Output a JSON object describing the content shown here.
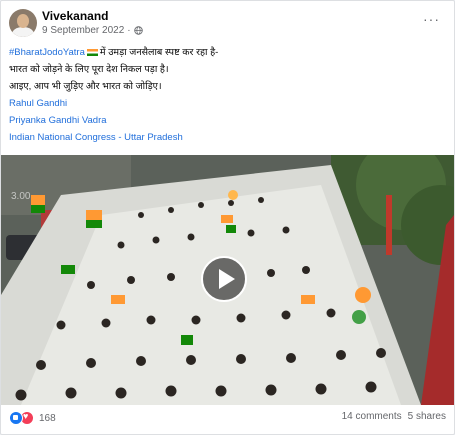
{
  "post": {
    "author": "Vivekanand",
    "date": "9 September 2022",
    "separator": "·",
    "more": "···",
    "hashtag": "#BharatJodoYatra",
    "line1_rest": "में उमड़ा जनसैलाब स्पष्ट कर रहा है-",
    "line2": "भारत को जोड़ने के लिए पूरा देश निकल पड़ा है।",
    "line3": "आइए, आप भी जुड़िए और भारत को जोड़िए।",
    "tags": [
      "Rahul Gandhi",
      "Priyanka Gandhi Vadra",
      "Indian National Congress - Uttar Pradesh"
    ]
  },
  "video": {
    "watermark": "3.00"
  },
  "footer": {
    "reaction_count": "168",
    "comments": "14 comments",
    "shares": "5 shares"
  },
  "colors": {
    "link": "#216fdb",
    "like": "#1877f2",
    "love": "#f33e58",
    "saffron": "#ff9933",
    "green": "#138808"
  },
  "icons": [
    "globe-icon",
    "more-icon",
    "flag-icon",
    "play-icon",
    "like-icon",
    "love-icon"
  ]
}
